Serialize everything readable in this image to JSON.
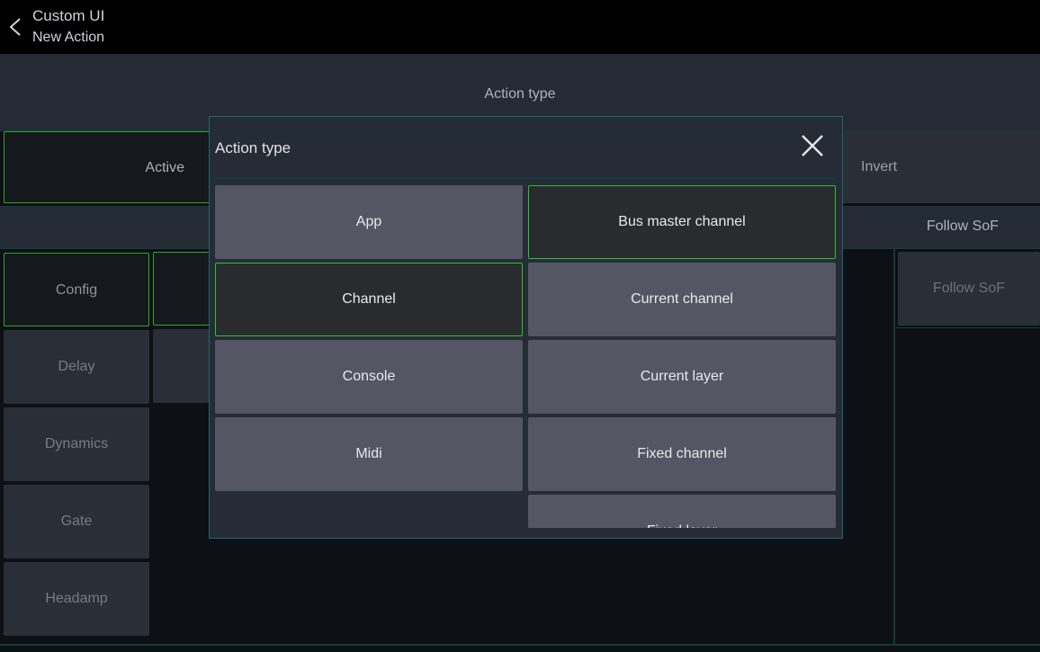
{
  "topbar": {
    "title": "Custom UI",
    "subtitle": "New Action",
    "back_icon": "chevron-left-icon"
  },
  "background": {
    "section_title": "Action type",
    "active_label": "Active",
    "invert_label": "Invert",
    "follow_header": "Follow SoF",
    "follow_button": "Follow SoF",
    "left_items": [
      {
        "label": "Config"
      },
      {
        "label": "Delay"
      },
      {
        "label": "Dynamics"
      },
      {
        "label": "Gate"
      },
      {
        "label": "Headamp"
      }
    ]
  },
  "modal": {
    "title": "Action type",
    "close_icon": "close-icon",
    "options": [
      {
        "label": "App",
        "selected": false
      },
      {
        "label": "Bus master channel",
        "selected": true
      },
      {
        "label": "Channel",
        "selected": true
      },
      {
        "label": "Current channel",
        "selected": false
      },
      {
        "label": "Console",
        "selected": false
      },
      {
        "label": "Current layer",
        "selected": false
      },
      {
        "label": "Midi",
        "selected": false
      },
      {
        "label": "Fixed channel",
        "selected": false
      },
      {
        "label": "Fixed layer",
        "selected": false
      }
    ]
  },
  "colors": {
    "accent_green": "#2ec02e",
    "teal_border": "#1f6670",
    "panel": "#262c36"
  }
}
